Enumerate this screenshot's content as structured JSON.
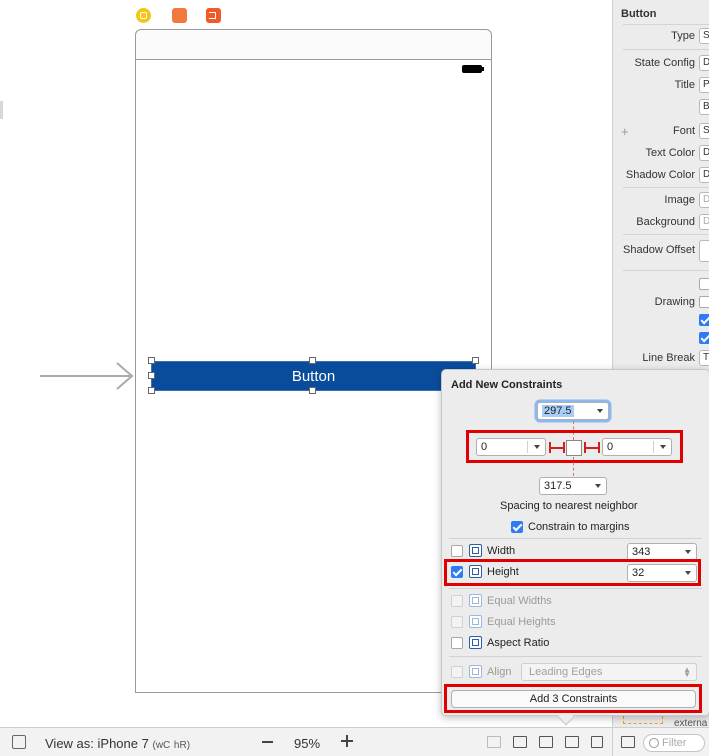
{
  "canvas": {
    "button_title": "Button"
  },
  "inspector": {
    "section_title": "Button",
    "rows": {
      "type": "Type",
      "state_config": "State Config",
      "title": "Title",
      "font": "Font",
      "text_color": "Text Color",
      "shadow_color": "Shadow Color",
      "image": "Image",
      "background": "Background",
      "shadow_offset": "Shadow Offset",
      "drawing": "Drawing",
      "line_break": "Line Break"
    },
    "values": {
      "type": "S",
      "state_config": "D",
      "title": "P",
      "title_value": "B",
      "font": "S",
      "text_color": "D",
      "shadow_color": "D",
      "image": "D",
      "background": "D",
      "line_break": "T"
    },
    "extra_text": "externa"
  },
  "popover": {
    "title": "Add New Constraints",
    "top_spacing": "297.5",
    "leading_spacing": "0",
    "trailing_spacing": "0",
    "bottom_spacing": "317.5",
    "spacing_caption": "Spacing to nearest neighbor",
    "constrain_to_margins": "Constrain to margins",
    "width_label": "Width",
    "width_value": "343",
    "height_label": "Height",
    "height_value": "32",
    "equal_widths": "Equal Widths",
    "equal_heights": "Equal Heights",
    "aspect_ratio": "Aspect Ratio",
    "align_label": "Align",
    "align_value": "Leading Edges",
    "add_button": "Add 3 Constraints"
  },
  "bottombar": {
    "view_as": "View as: iPhone 7",
    "size_class_w": "wC",
    "size_class_h": "hR",
    "zoom": "95%",
    "filter_placeholder": "Filter"
  },
  "colors": {
    "button_blue": "#0a4c9c",
    "highlight_red": "#e00000",
    "check_blue": "#2f7bf5"
  }
}
